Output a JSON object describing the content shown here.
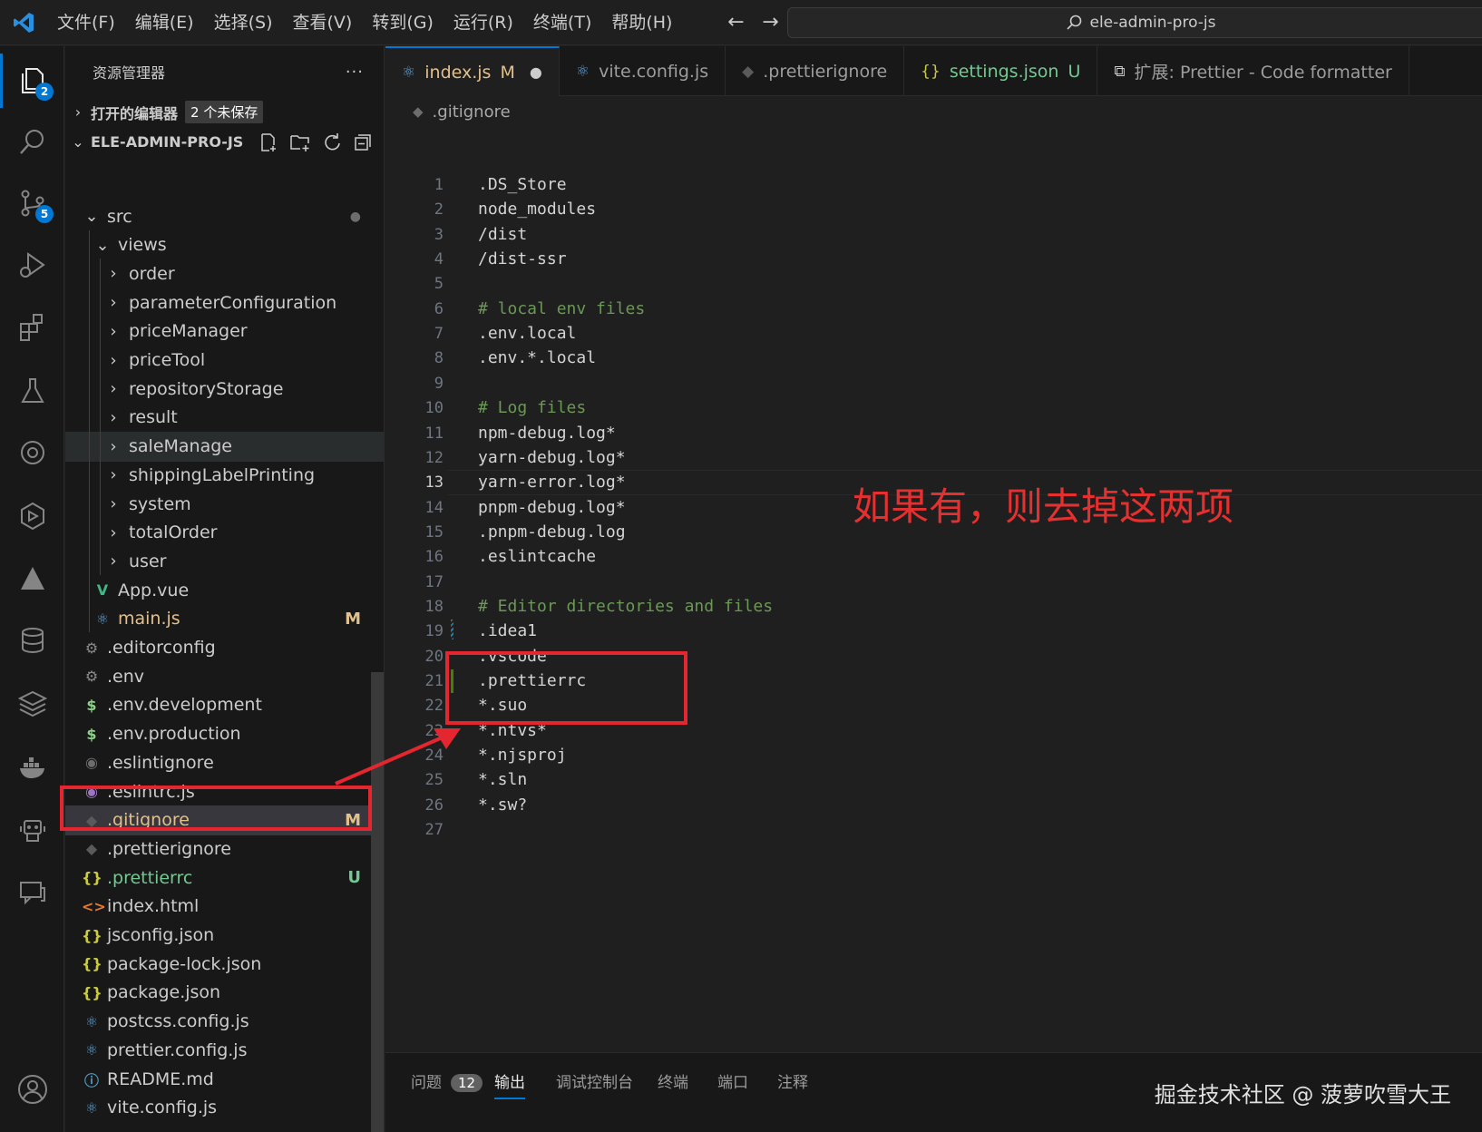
{
  "menu": [
    "文件(F)",
    "编辑(E)",
    "选择(S)",
    "查看(V)",
    "转到(G)",
    "运行(R)",
    "终端(T)",
    "帮助(H)"
  ],
  "search": {
    "value": "ele-admin-pro-js"
  },
  "activity_badges": {
    "explorer": "2",
    "scm": "5"
  },
  "sidebar": {
    "title": "资源管理器",
    "more": "···",
    "open_editors": "打开的编辑器",
    "unsaved": "2 个未保存",
    "project": "ELE-ADMIN-PRO-JS",
    "rows": [
      {
        "label": "src",
        "kind": "folder-open",
        "status": "●"
      },
      {
        "label": "views",
        "kind": "folder-open",
        "status": ""
      },
      {
        "label": "order",
        "kind": "folder",
        "status": ""
      },
      {
        "label": "parameterConfiguration",
        "kind": "folder",
        "status": ""
      },
      {
        "label": "priceManager",
        "kind": "folder",
        "status": ""
      },
      {
        "label": "priceTool",
        "kind": "folder",
        "status": ""
      },
      {
        "label": "repositoryStorage",
        "kind": "folder",
        "status": ""
      },
      {
        "label": "result",
        "kind": "folder",
        "status": ""
      },
      {
        "label": "saleManage",
        "kind": "folder",
        "status": ""
      },
      {
        "label": "shippingLabelPrinting",
        "kind": "folder",
        "status": ""
      },
      {
        "label": "system",
        "kind": "folder",
        "status": ""
      },
      {
        "label": "totalOrder",
        "kind": "folder",
        "status": ""
      },
      {
        "label": "user",
        "kind": "folder",
        "status": ""
      },
      {
        "label": "App.vue",
        "kind": "vue",
        "status": ""
      },
      {
        "label": "main.js",
        "kind": "react",
        "status": "M"
      },
      {
        "label": ".editorconfig",
        "kind": "gear",
        "status": ""
      },
      {
        "label": ".env",
        "kind": "gear",
        "status": ""
      },
      {
        "label": ".env.development",
        "kind": "dollar",
        "status": ""
      },
      {
        "label": ".env.production",
        "kind": "dollar",
        "status": ""
      },
      {
        "label": ".eslintignore",
        "kind": "circle",
        "status": ""
      },
      {
        "label": ".eslintrc.js",
        "kind": "eslint",
        "status": ""
      },
      {
        "label": ".gitignore",
        "kind": "git",
        "status": "M"
      },
      {
        "label": ".prettierignore",
        "kind": "git",
        "status": ""
      },
      {
        "label": ".prettierrc",
        "kind": "json",
        "status": "U"
      },
      {
        "label": "index.html",
        "kind": "html",
        "status": ""
      },
      {
        "label": "jsconfig.json",
        "kind": "json",
        "status": ""
      },
      {
        "label": "package-lock.json",
        "kind": "json",
        "status": ""
      },
      {
        "label": "package.json",
        "kind": "json",
        "status": ""
      },
      {
        "label": "postcss.config.js",
        "kind": "react",
        "status": ""
      },
      {
        "label": "prettier.config.js",
        "kind": "react",
        "status": ""
      },
      {
        "label": "README.md",
        "kind": "info",
        "status": ""
      },
      {
        "label": "vite.config.js",
        "kind": "react",
        "status": ""
      }
    ]
  },
  "tabs": [
    {
      "label": "index.js",
      "status": "M",
      "dot": "●",
      "icon": "react"
    },
    {
      "label": "vite.config.js",
      "status": "",
      "dot": "",
      "icon": "react"
    },
    {
      "label": ".prettierignore",
      "status": "",
      "dot": "",
      "icon": "git"
    },
    {
      "label": "settings.json",
      "status": "U",
      "dot": "",
      "icon": "json"
    },
    {
      "label": "扩展: Prettier - Code formatter",
      "status": "",
      "dot": "",
      "icon": "ext"
    }
  ],
  "breadcrumb": ".gitignore",
  "editor": {
    "current_line": 13,
    "lines": [
      {
        "n": "1",
        "text": ".DS_Store",
        "type": "code"
      },
      {
        "n": "2",
        "text": "node_modules",
        "type": "code"
      },
      {
        "n": "3",
        "text": "/dist",
        "type": "code"
      },
      {
        "n": "4",
        "text": "/dist-ssr",
        "type": "code"
      },
      {
        "n": "5",
        "text": "",
        "type": "code"
      },
      {
        "n": "6",
        "text": "# local env files",
        "type": "comment"
      },
      {
        "n": "7",
        "text": ".env.local",
        "type": "code"
      },
      {
        "n": "8",
        "text": ".env.*.local",
        "type": "code"
      },
      {
        "n": "9",
        "text": "",
        "type": "code"
      },
      {
        "n": "10",
        "text": "# Log files",
        "type": "comment"
      },
      {
        "n": "11",
        "text": "npm-debug.log*",
        "type": "code"
      },
      {
        "n": "12",
        "text": "yarn-debug.log*",
        "type": "code"
      },
      {
        "n": "13",
        "text": "yarn-error.log*",
        "type": "code"
      },
      {
        "n": "14",
        "text": "pnpm-debug.log*",
        "type": "code"
      },
      {
        "n": "15",
        "text": ".pnpm-debug.log",
        "type": "code"
      },
      {
        "n": "16",
        "text": ".eslintcache",
        "type": "code"
      },
      {
        "n": "17",
        "text": "",
        "type": "code"
      },
      {
        "n": "18",
        "text": "# Editor directories and files",
        "type": "comment"
      },
      {
        "n": "19",
        "text": ".idea1",
        "type": "code"
      },
      {
        "n": "20",
        "text": ".vscode",
        "type": "code"
      },
      {
        "n": "21",
        "text": ".prettierrc",
        "type": "code"
      },
      {
        "n": "22",
        "text": "*.suo",
        "type": "code"
      },
      {
        "n": "23",
        "text": "*.ntvs*",
        "type": "code"
      },
      {
        "n": "24",
        "text": "*.njsproj",
        "type": "code"
      },
      {
        "n": "25",
        "text": "*.sln",
        "type": "code"
      },
      {
        "n": "26",
        "text": "*.sw?",
        "type": "code"
      },
      {
        "n": "27",
        "text": "",
        "type": "code"
      }
    ]
  },
  "annotation": {
    "text": "如果有，则去掉这两项",
    "color": "#e63030"
  },
  "panel": {
    "tabs": [
      {
        "label": "问题",
        "badge": "12"
      },
      {
        "label": "输出",
        "badge": ""
      },
      {
        "label": "调试控制台",
        "badge": ""
      },
      {
        "label": "终端",
        "badge": ""
      },
      {
        "label": "端口",
        "badge": ""
      },
      {
        "label": "注释",
        "badge": ""
      }
    ],
    "active": "输出"
  },
  "watermark": "掘金技术社区 @ 菠萝吹雪大王",
  "colors": {
    "accent": "#0078d4",
    "modified": "#e2c08d",
    "untracked": "#73c991",
    "annotation_red": "#e3262f"
  }
}
